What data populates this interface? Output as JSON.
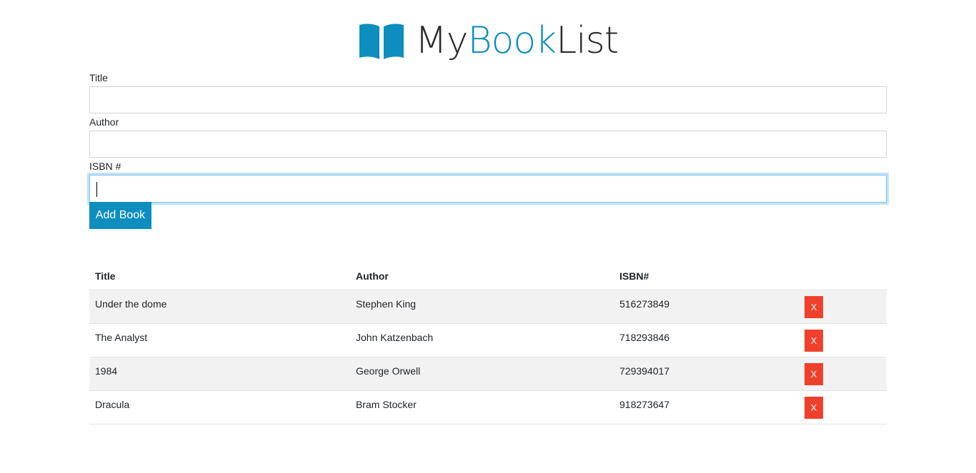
{
  "header": {
    "logo_icon": "open-book-icon",
    "logo_part_1": "My",
    "logo_part_2": "Book",
    "logo_part_3": "List",
    "accent_color": "#0e8ebf"
  },
  "form": {
    "title_label": "Title",
    "title_value": "",
    "author_label": "Author",
    "author_value": "",
    "isbn_label": "ISBN #",
    "isbn_value": "",
    "add_button_label": "Add Book",
    "button_color": "#0e8ebf"
  },
  "table": {
    "headers": [
      "Title",
      "Author",
      "ISBN#",
      ""
    ],
    "rows": [
      {
        "title": "Under the dome",
        "author": "Stephen King",
        "isbn": "516273849",
        "delete_label": "X"
      },
      {
        "title": "The Analyst",
        "author": "John Katzenbach",
        "isbn": "718293846",
        "delete_label": "X"
      },
      {
        "title": "1984",
        "author": "George Orwell",
        "isbn": "729394017",
        "delete_label": "X"
      },
      {
        "title": "Dracula",
        "author": "Bram Stocker",
        "isbn": "918273647",
        "delete_label": "X"
      }
    ],
    "delete_color": "#f0402c"
  }
}
